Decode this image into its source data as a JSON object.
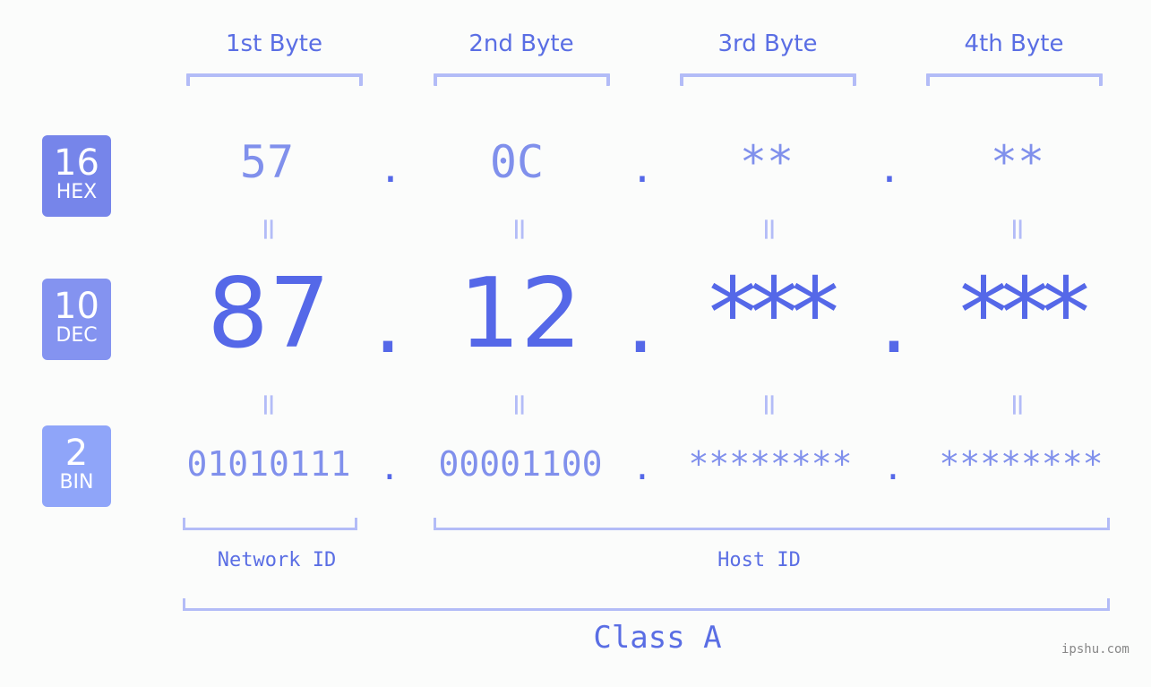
{
  "byte_headers": [
    "1st Byte",
    "2nd Byte",
    "3rd Byte",
    "4th Byte"
  ],
  "badges": {
    "hex": {
      "number": "16",
      "label": "HEX",
      "color": "#7685ea"
    },
    "dec": {
      "number": "10",
      "label": "DEC",
      "color": "#8493f0"
    },
    "bin": {
      "number": "2",
      "label": "BIN",
      "color": "#8fa5f9"
    }
  },
  "rows": {
    "hex": [
      "57",
      "0C",
      "**",
      "**"
    ],
    "dec": [
      "87",
      "12",
      "***",
      "***"
    ],
    "bin": [
      "01010111",
      "00001100",
      "********",
      "********"
    ]
  },
  "separator": ".",
  "equals_sign": "=",
  "segments": {
    "network_id": "Network ID",
    "host_id": "Host ID",
    "class": "Class A"
  },
  "watermark": "ipshu.com",
  "colors": {
    "accent": "#5568e8",
    "light_accent": "#8090ec",
    "bracket": "#b3bcf7",
    "background": "#fbfcfb"
  }
}
